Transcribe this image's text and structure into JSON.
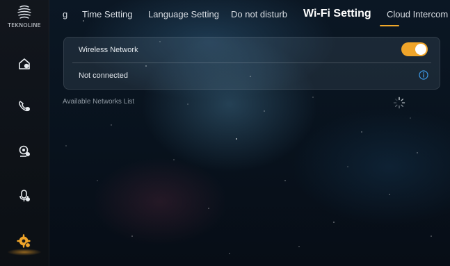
{
  "brand": {
    "name": "TEKNOLINE"
  },
  "sidebar": {
    "items": [
      {
        "id": "home",
        "icon": "home-icon"
      },
      {
        "id": "calls",
        "icon": "phone-icon"
      },
      {
        "id": "monitor",
        "icon": "camera-icon"
      },
      {
        "id": "recordings",
        "icon": "record-icon"
      },
      {
        "id": "settings",
        "icon": "gear-icon",
        "active": true
      }
    ]
  },
  "tabs": [
    {
      "label": "g"
    },
    {
      "label": "Time Setting"
    },
    {
      "label": "Language Setting"
    },
    {
      "label": "Do not disturb"
    },
    {
      "label": "Wi-Fi Setting",
      "active": true
    },
    {
      "label": "Cloud Intercom"
    }
  ],
  "wifi": {
    "wireless_label": "Wireless Network",
    "wireless_enabled": true,
    "status_text": "Not connected",
    "available_label": "Available Networks List"
  },
  "colors": {
    "accent": "#f0a52a",
    "info": "#3d9be9"
  }
}
